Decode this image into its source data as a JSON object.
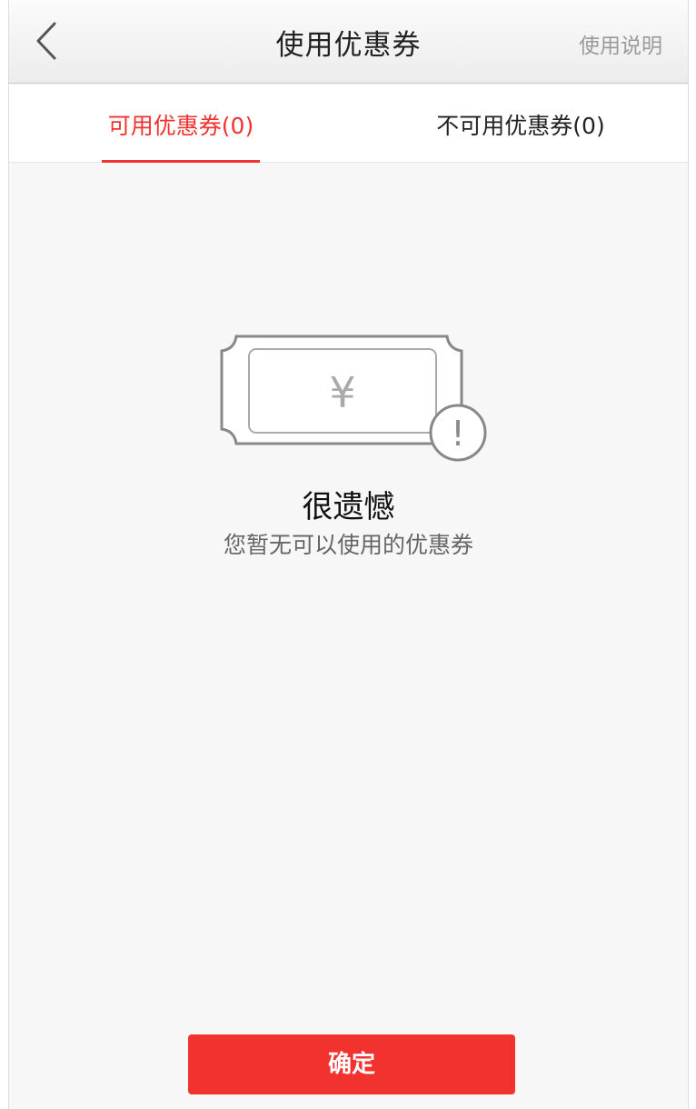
{
  "header": {
    "title": "使用优惠券",
    "right_link": "使用说明",
    "back_icon": "chevron-left-icon"
  },
  "tabs": [
    {
      "label": "可用优惠券(0)",
      "active": true
    },
    {
      "label": "不可用优惠券(0)",
      "active": false
    }
  ],
  "empty_state": {
    "icon": "coupon-ticket-icon",
    "currency_symbol": "¥",
    "alert_mark": "!",
    "title": "很遗憾",
    "subtitle": "您暂无可以使用的优惠券"
  },
  "footer": {
    "confirm_label": "确定"
  },
  "colors": {
    "accent": "#f2322f",
    "background": "#f7f7f7"
  }
}
